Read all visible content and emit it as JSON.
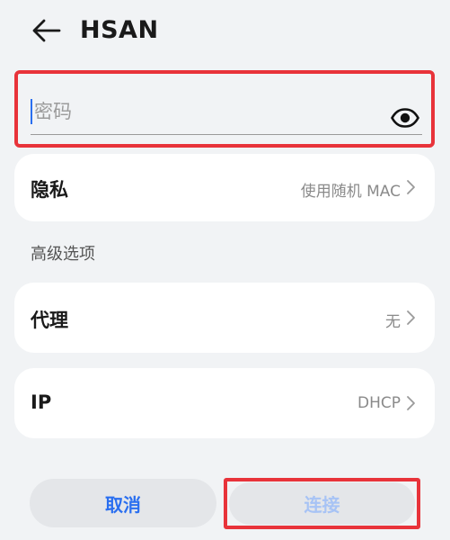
{
  "header": {
    "title": "HSAN",
    "back_icon": "back-arrow-icon"
  },
  "password": {
    "placeholder": "密码",
    "value": "",
    "toggle_icon": "eye-icon"
  },
  "privacy": {
    "label": "隐私",
    "value": "使用随机 MAC"
  },
  "advanced": {
    "section_title": "高级选项",
    "proxy": {
      "label": "代理",
      "value": "无"
    },
    "ip": {
      "label": "IP",
      "value": "DHCP"
    }
  },
  "actions": {
    "cancel_label": "取消",
    "connect_label": "连接"
  },
  "colors": {
    "accent": "#2a6ff0",
    "highlight": "#e8333a",
    "disabled_accent": "#a7c3f5",
    "background": "#f1f3f5"
  }
}
